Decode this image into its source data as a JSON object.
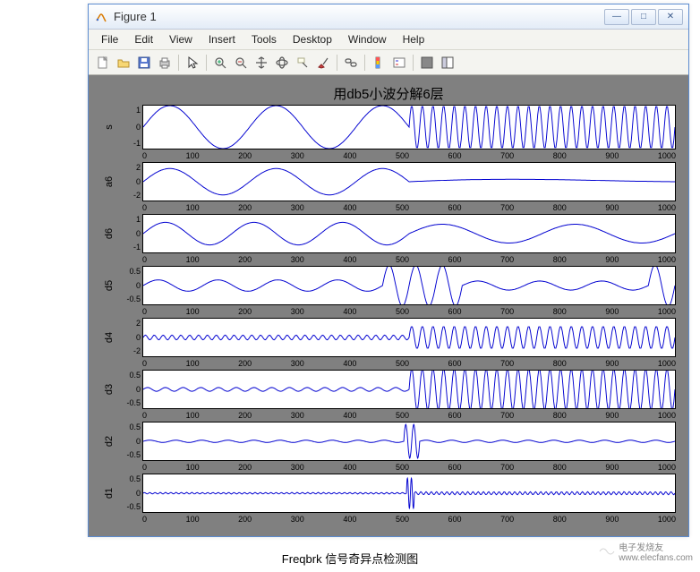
{
  "window": {
    "title": "Figure 1",
    "min_label": "—",
    "max_label": "□",
    "close_label": "✕"
  },
  "menu": [
    "File",
    "Edit",
    "View",
    "Insert",
    "Tools",
    "Desktop",
    "Window",
    "Help"
  ],
  "toolbar_icons": [
    "new-file-icon",
    "open-icon",
    "save-icon",
    "print-icon",
    "|",
    "pointer-icon",
    "|",
    "zoom-in-icon",
    "zoom-out-icon",
    "pan-icon",
    "rotate3d-icon",
    "datacursor-icon",
    "brush-icon",
    "|",
    "link-icon",
    "|",
    "colorbar-icon",
    "legend-icon",
    "|",
    "hide-icon",
    "show-icon"
  ],
  "chart_title": "用db5小波分解6层",
  "caption": "Freqbrk 信号奇异点检测图",
  "watermark": {
    "brand": "电子发烧友",
    "url": "www.elecfans.com"
  },
  "chart_data": [
    {
      "name": "s",
      "type": "line",
      "xlabel": "",
      "ylabel": "s",
      "xlim": [
        0,
        1000
      ],
      "ylim": [
        -1,
        1
      ],
      "xticks": [
        0,
        100,
        200,
        300,
        400,
        500,
        600,
        700,
        800,
        900,
        1000
      ],
      "yticks": [
        -1,
        0,
        1
      ],
      "description": "original freqbrk signal: sin(2πf1 t) for t<500, sin(2πf2 t) for t>=500",
      "segments": [
        {
          "x_range": [
            0,
            500
          ],
          "freq_cycles": 2.5,
          "amp": 1.0
        },
        {
          "x_range": [
            500,
            1000
          ],
          "freq_cycles": 25,
          "amp": 1.0
        }
      ]
    },
    {
      "name": "a6",
      "type": "line",
      "ylabel": "a6",
      "xlim": [
        0,
        1000
      ],
      "ylim": [
        -2,
        2
      ],
      "xticks": [
        0,
        100,
        200,
        300,
        400,
        500,
        600,
        700,
        800,
        900,
        1000
      ],
      "yticks": [
        -2,
        0,
        2
      ],
      "segments": [
        {
          "x_range": [
            0,
            500
          ],
          "freq_cycles": 2.5,
          "amp": 1.4
        },
        {
          "x_range": [
            500,
            1000
          ],
          "freq_cycles": 0.5,
          "amp": 0.4,
          "decay": true
        }
      ]
    },
    {
      "name": "d6",
      "type": "line",
      "ylabel": "d6",
      "xlim": [
        0,
        1000
      ],
      "ylim": [
        -1,
        1
      ],
      "xticks": [
        0,
        100,
        200,
        300,
        400,
        500,
        600,
        700,
        800,
        900,
        1000
      ],
      "yticks": [
        -1,
        0,
        1
      ],
      "segments": [
        {
          "x_range": [
            0,
            500
          ],
          "freq_cycles": 3,
          "amp": 0.6
        },
        {
          "x_range": [
            500,
            1000
          ],
          "freq_cycles": 2,
          "amp": 0.5
        }
      ]
    },
    {
      "name": "d5",
      "type": "line",
      "ylabel": "d5",
      "xlim": [
        0,
        1000
      ],
      "ylim": [
        -0.5,
        0.5
      ],
      "xticks": [
        0,
        100,
        200,
        300,
        400,
        500,
        600,
        700,
        800,
        900,
        1000
      ],
      "yticks": [
        -0.5,
        0,
        0.5
      ],
      "segments": [
        {
          "x_range": [
            0,
            450
          ],
          "freq_cycles": 4,
          "amp": 0.15
        },
        {
          "x_range": [
            450,
            600
          ],
          "freq_cycles": 3,
          "amp": 0.55
        },
        {
          "x_range": [
            600,
            950
          ],
          "freq_cycles": 3,
          "amp": 0.12
        },
        {
          "x_range": [
            950,
            1000
          ],
          "freq_cycles": 1,
          "amp": 0.55
        }
      ]
    },
    {
      "name": "d4",
      "type": "line",
      "ylabel": "d4",
      "xlim": [
        0,
        1000
      ],
      "ylim": [
        -2,
        2
      ],
      "xticks": [
        0,
        100,
        200,
        300,
        400,
        500,
        600,
        700,
        800,
        900,
        1000
      ],
      "yticks": [
        -2,
        0,
        2
      ],
      "segments": [
        {
          "x_range": [
            0,
            500
          ],
          "freq_cycles": 30,
          "amp": 0.25
        },
        {
          "x_range": [
            500,
            1000
          ],
          "freq_cycles": 25,
          "amp": 1.2
        }
      ]
    },
    {
      "name": "d3",
      "type": "line",
      "ylabel": "d3",
      "xlim": [
        0,
        1000
      ],
      "ylim": [
        -0.5,
        0.5
      ],
      "xticks": [
        0,
        100,
        200,
        300,
        400,
        500,
        600,
        700,
        800,
        900,
        1000
      ],
      "yticks": [
        -0.5,
        0,
        0.5
      ],
      "segments": [
        {
          "x_range": [
            0,
            500
          ],
          "freq_cycles": 15,
          "amp": 0.05
        },
        {
          "x_range": [
            500,
            1000
          ],
          "freq_cycles": 25,
          "amp": 0.55
        }
      ]
    },
    {
      "name": "d2",
      "type": "line",
      "ylabel": "d2",
      "xlim": [
        0,
        1000
      ],
      "ylim": [
        -0.5,
        0.5
      ],
      "xticks": [
        0,
        100,
        200,
        300,
        400,
        500,
        600,
        700,
        800,
        900,
        1000
      ],
      "yticks": [
        -0.5,
        0,
        0.5
      ],
      "segments": [
        {
          "x_range": [
            0,
            490
          ],
          "freq_cycles": 10,
          "amp": 0.03
        },
        {
          "x_range": [
            490,
            520
          ],
          "freq_cycles": 2,
          "amp": 0.45
        },
        {
          "x_range": [
            520,
            1000
          ],
          "freq_cycles": 10,
          "amp": 0.03
        }
      ]
    },
    {
      "name": "d1",
      "type": "line",
      "ylabel": "d1",
      "xlim": [
        0,
        1000
      ],
      "ylim": [
        -0.5,
        0.5
      ],
      "xticks": [
        0,
        100,
        200,
        300,
        400,
        500,
        600,
        700,
        800,
        900,
        1000
      ],
      "yticks": [
        -0.5,
        0,
        0.5
      ],
      "segments": [
        {
          "x_range": [
            0,
            495
          ],
          "freq_cycles": 50,
          "amp": 0.02
        },
        {
          "x_range": [
            495,
            510
          ],
          "freq_cycles": 2,
          "amp": 0.4
        },
        {
          "x_range": [
            510,
            1000
          ],
          "freq_cycles": 50,
          "amp": 0.04
        }
      ]
    }
  ]
}
